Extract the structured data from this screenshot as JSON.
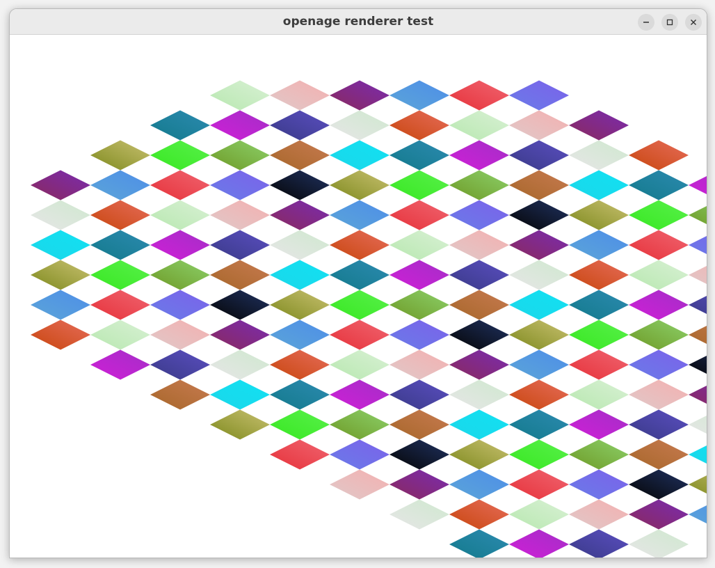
{
  "window": {
    "title": "openage renderer test",
    "controls": [
      {
        "name": "minimize-button",
        "icon": "minimize-icon"
      },
      {
        "name": "maximize-button",
        "icon": "maximize-icon"
      },
      {
        "name": "close-button",
        "icon": "close-icon"
      }
    ]
  },
  "canvas": {
    "description_type": "isometric-diamond-tile-pattern",
    "background": "#ffffff",
    "tile_palette": [
      [
        "#050505",
        "#1f3160"
      ],
      [
        "#3a3a88",
        "#5a4ec0"
      ],
      [
        "#6a7be8",
        "#7b62ea"
      ],
      [
        "#cf1fd6",
        "#a42ec8"
      ],
      [
        "#e6323a",
        "#f06470"
      ],
      [
        "#137a8c",
        "#2c8ab0"
      ],
      [
        "#5ba5d8",
        "#4e8ee8"
      ],
      [
        "#1ad8ea",
        "#12e0f2"
      ],
      [
        "#8a2a5e",
        "#7a2bb0"
      ],
      [
        "#a7672a",
        "#c77a50"
      ],
      [
        "#e0c8c8",
        "#f4b0b0"
      ],
      [
        "#6e9a26",
        "#8cd06a"
      ],
      [
        "#b8e8b0",
        "#d8f0d4"
      ],
      [
        "#38e822",
        "#58f04a"
      ],
      [
        "#c8460e",
        "#e66c5a"
      ],
      [
        "#7e8a1e",
        "#c8c070"
      ],
      [
        "#e6e6e6",
        "#cfe8cf"
      ]
    ]
  }
}
